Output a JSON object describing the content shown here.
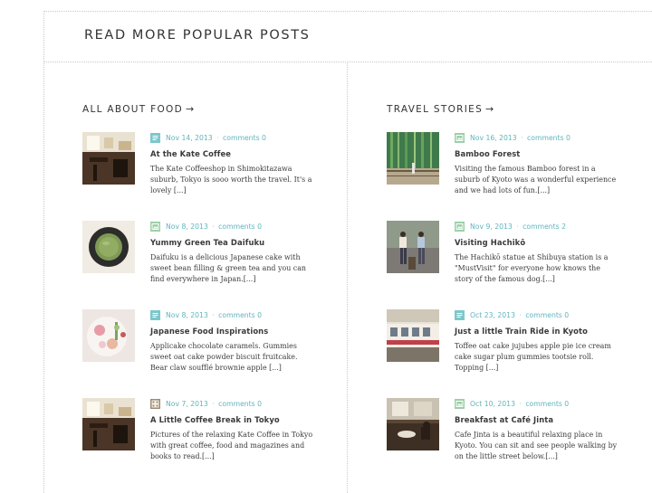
{
  "section_title": "READ MORE POPULAR POSTS",
  "columns": [
    {
      "heading": "ALL ABOUT FOOD",
      "arrow": "→",
      "posts": [
        {
          "date": "Nov 14, 2013",
          "sep": "·",
          "comments": "comments 0",
          "title": "At the Kate Coffee",
          "excerpt": "The Kate Coffeeshop in Shimokitazawa suburb, Tokyo is sooo worth the travel. It's a lovely [...]",
          "format_icon": "standard-icon"
        },
        {
          "date": "Nov 8, 2013",
          "sep": "·",
          "comments": "comments 0",
          "title": "Yummy Green Tea Daifuku",
          "excerpt": "Daifuku is a delicious Japanese cake with sweet bean filling & green tea and you can find everywhere in Japan.[...]",
          "format_icon": "image-icon"
        },
        {
          "date": "Nov 8, 2013",
          "sep": "·",
          "comments": "comments 0",
          "title": "Japanese Food Inspirations",
          "excerpt": "Applicake chocolate caramels. Gummies sweet oat cake powder biscuit fruitcake. Bear claw soufflé brownie apple [...]",
          "format_icon": "standard-icon"
        },
        {
          "date": "Nov 7, 2013",
          "sep": "·",
          "comments": "comments 0",
          "title": "A Little Coffee Break in Tokyo",
          "excerpt": "Pictures of the relaxing Kate Coffee in Tokyo with great coffee, food and magazines and books to read.[...]",
          "format_icon": "gallery-icon"
        }
      ]
    },
    {
      "heading": "TRAVEL STORIES",
      "arrow": "→",
      "posts": [
        {
          "date": "Nov 16, 2013",
          "sep": "·",
          "comments": "comments 0",
          "title": "Bamboo Forest",
          "excerpt": "Visiting the famous Bamboo forest in a suburb of Kyoto was a wonderful experience and we had lots of fun.[...]",
          "format_icon": "image-icon"
        },
        {
          "date": "Nov 9, 2013",
          "sep": "·",
          "comments": "comments 2",
          "title": "Visiting Hachikō",
          "excerpt": "The Hachikō statue at Shibuya station is a \"MustVisit\" for everyone how knows the story of the famous dog.[...]",
          "format_icon": "image-icon"
        },
        {
          "date": "Oct 23, 2013",
          "sep": "·",
          "comments": "comments 0",
          "title": "Just a little Train Ride in Kyoto",
          "excerpt": "Toffee oat cake jujubes apple pie ice cream cake sugar plum gummies tootsie roll. Topping [...]",
          "format_icon": "standard-icon"
        },
        {
          "date": "Oct 10, 2013",
          "sep": "·",
          "comments": "comments 0",
          "title": "Breakfast at Café Jinta",
          "excerpt": "Cafe Jinta is a beautiful relaxing place in Kyoto. You can sit and see people walking by on the little street below.[...]",
          "format_icon": "image-icon"
        }
      ]
    }
  ],
  "colors": {
    "meta_teal": "#5fb5bd",
    "standard_icon_bg": "#7cc7cc",
    "image_icon_bg": "#9dcfa9",
    "gallery_icon_bg": "#a08a6e"
  }
}
